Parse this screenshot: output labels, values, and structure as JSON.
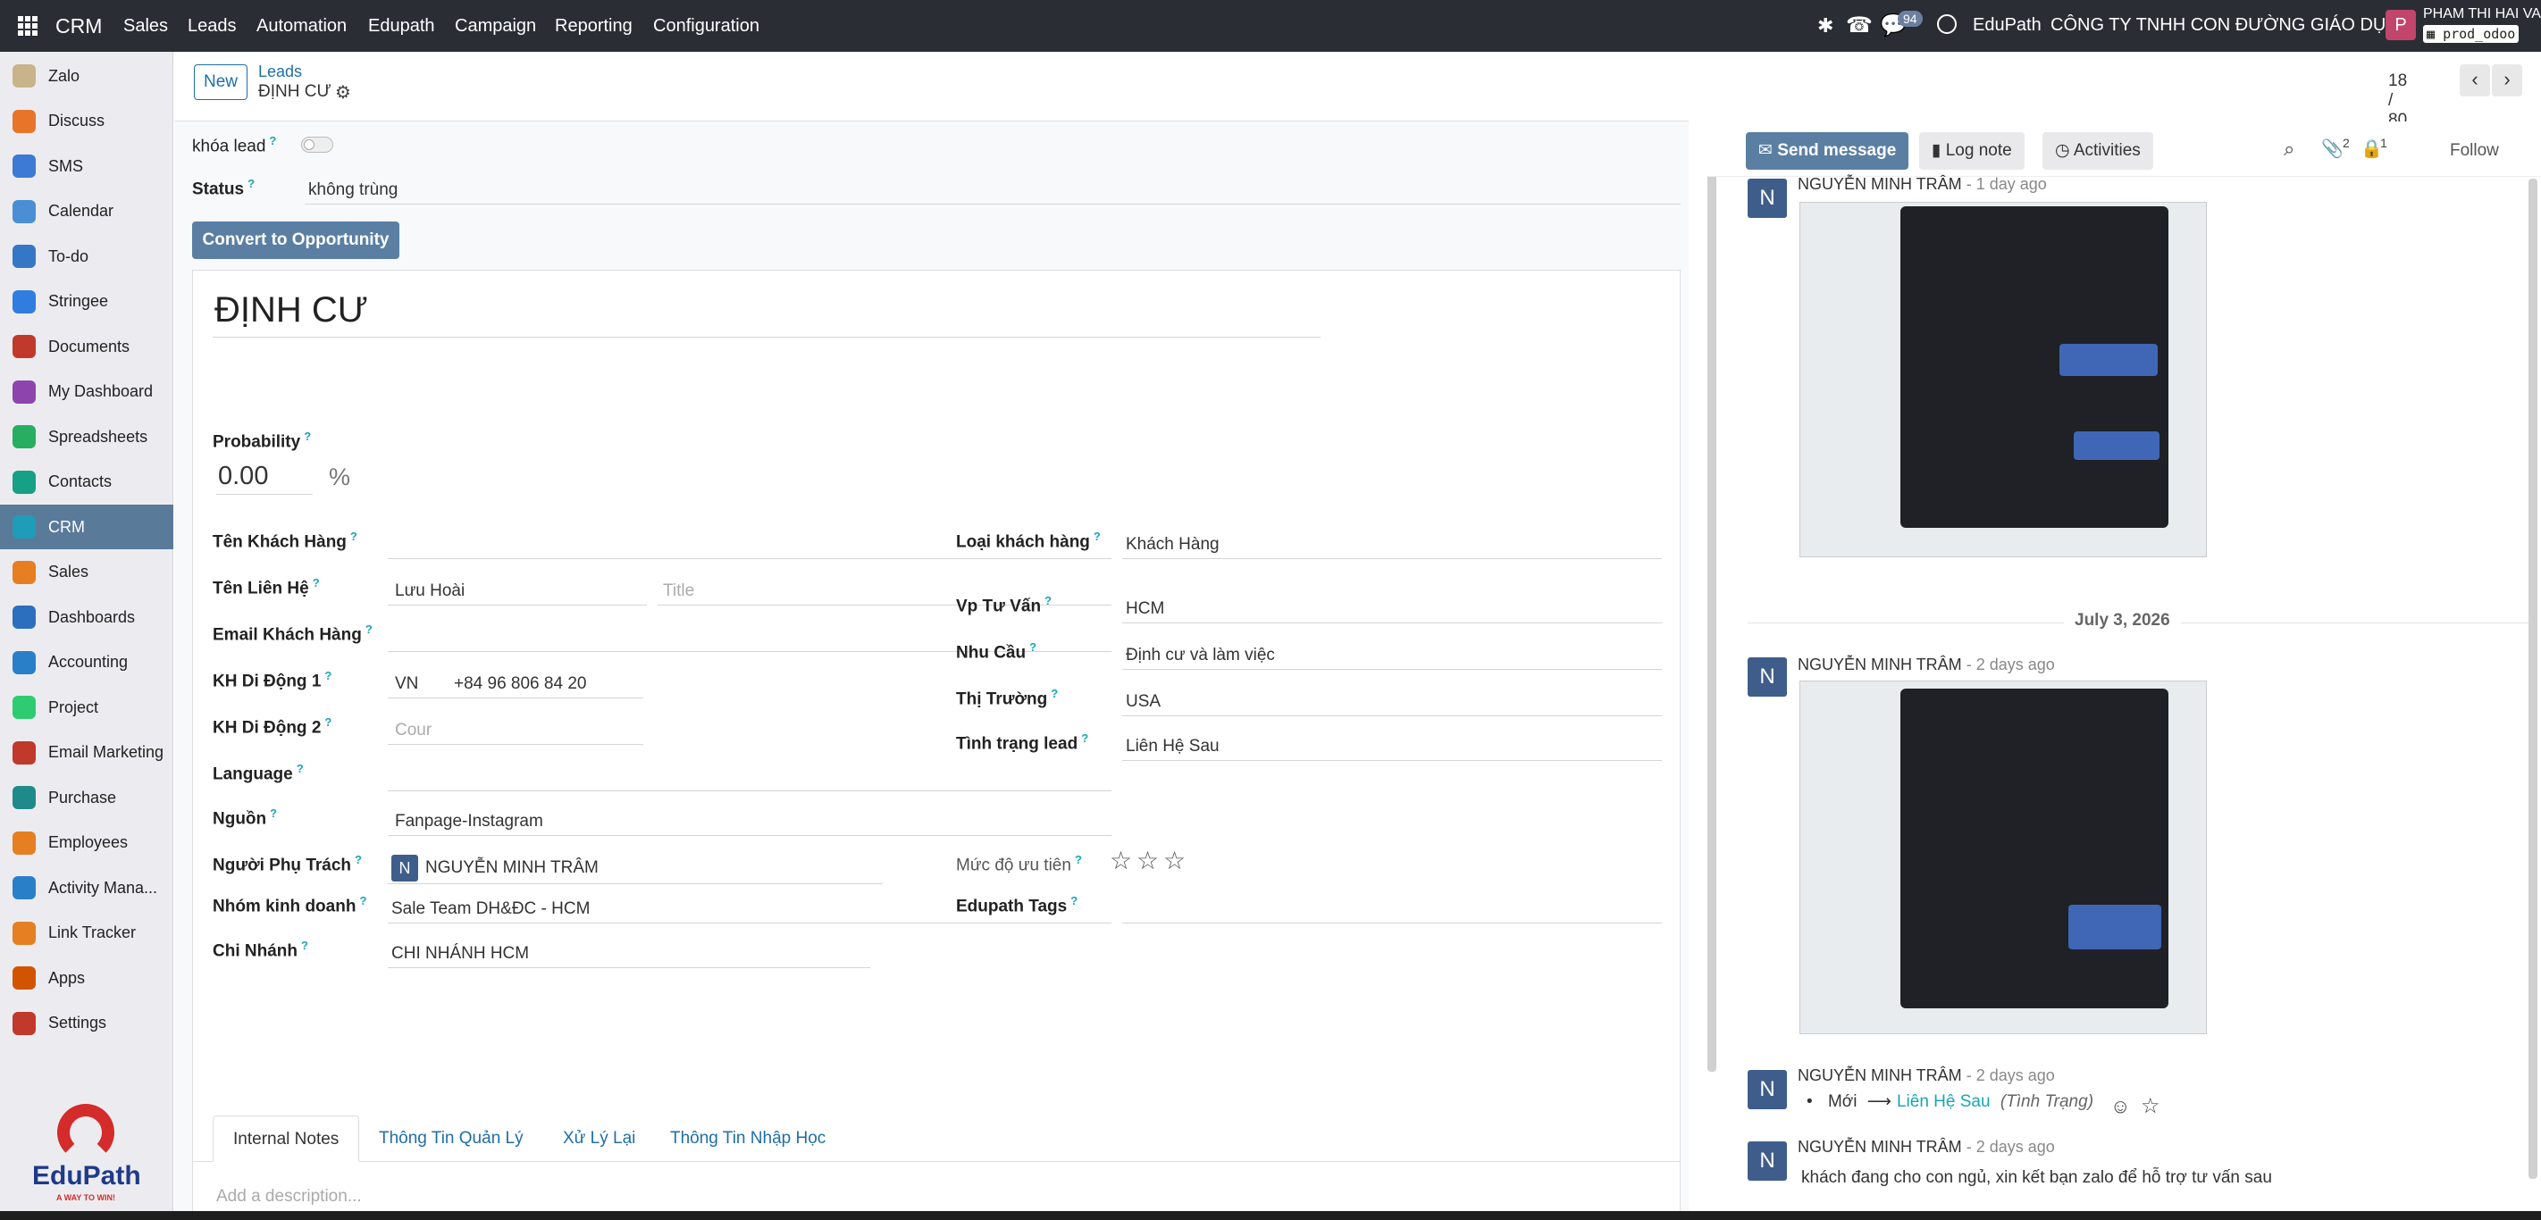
{
  "topbar": {
    "app_name": "CRM",
    "menu": [
      "Sales",
      "Leads",
      "Automation",
      "Edupath",
      "Campaign",
      "Reporting",
      "Configuration"
    ],
    "message_count": "94",
    "company_short": "EduPath",
    "company_full": "CÔNG TY TNHH CON ĐƯỜNG GIÁO DỤC",
    "user_initial": "P",
    "user_name": "PHAM THI HAI VA",
    "db_name": "prod_odoo"
  },
  "sidebar": {
    "items": [
      {
        "label": "Zalo",
        "color": "#c9b38a"
      },
      {
        "label": "Discuss",
        "color": "#e8742a"
      },
      {
        "label": "SMS",
        "color": "#3c7ad6"
      },
      {
        "label": "Calendar",
        "color": "#4a8fd6"
      },
      {
        "label": "To-do",
        "color": "#3577c4"
      },
      {
        "label": "Stringee",
        "color": "#2f7de1"
      },
      {
        "label": "Documents",
        "color": "#c0392b"
      },
      {
        "label": "My Dashboard",
        "color": "#8e44ad"
      },
      {
        "label": "Spreadsheets",
        "color": "#27ae60"
      },
      {
        "label": "Contacts",
        "color": "#16a085"
      },
      {
        "label": "CRM",
        "color": "#1e9cb8"
      },
      {
        "label": "Sales",
        "color": "#e67e22"
      },
      {
        "label": "Dashboards",
        "color": "#2c6fbf"
      },
      {
        "label": "Accounting",
        "color": "#2a7fc9"
      },
      {
        "label": "Project",
        "color": "#2ecc71"
      },
      {
        "label": "Email Marketing",
        "color": "#c0392b"
      },
      {
        "label": "Purchase",
        "color": "#1f8a8a"
      },
      {
        "label": "Employees",
        "color": "#e67e22"
      },
      {
        "label": "Activity Mana...",
        "color": "#2a7fc9"
      },
      {
        "label": "Link Tracker",
        "color": "#e67e22"
      },
      {
        "label": "Apps",
        "color": "#d35400"
      },
      {
        "label": "Settings",
        "color": "#c0392b"
      }
    ],
    "logo_text": "EduPath",
    "logo_tagline": "A WAY TO WIN!"
  },
  "control": {
    "new_label": "New",
    "breadcrumb_parent": "Leads",
    "breadcrumb_current": "ĐỊNH CƯ",
    "pager": "18 / 80"
  },
  "form": {
    "lock_label": "khóa lead",
    "status_label": "Status",
    "status_value": "không trùng",
    "convert_label": "Convert to Opportunity",
    "title": "ĐỊNH CƯ",
    "probability_label": "Probability",
    "probability_value": "0.00",
    "percent": "%",
    "left": {
      "customer_name_label": "Tên Khách Hàng",
      "contact_name_label": "Tên Liên Hệ",
      "contact_name_value": "Lưu Hoài",
      "title_placeholder": "Title",
      "email_label": "Email Khách Hàng",
      "mobile1_label": "KH Di Động 1",
      "mobile1_country": "VN",
      "mobile1_value": "+84 96 806 84 20",
      "mobile2_label": "KH Di Động 2",
      "mobile2_placeholder": "Cour",
      "language_label": "Language",
      "source_label": "Nguồn",
      "source_value": "Fanpage-Instagram",
      "owner_label": "Người Phụ Trách",
      "owner_initial": "N",
      "owner_value": "NGUYỄN MINH TRÂM",
      "team_label": "Nhóm kinh doanh",
      "team_value": "Sale Team DH&ĐC - HCM",
      "branch_label": "Chi Nhánh",
      "branch_value": "CHI NHÁNH HCM"
    },
    "right": {
      "customer_type_label": "Loại khách hàng",
      "customer_type_value": "Khách Hàng",
      "office_label": "Vp Tư Vấn",
      "office_value": "HCM",
      "need_label": "Nhu Cầu",
      "need_value": "Định cư và làm việc",
      "market_label": "Thị Trường",
      "market_value": "USA",
      "lead_state_label": "Tình trạng lead",
      "lead_state_value": "Liên Hệ Sau",
      "priority_label": "Mức độ ưu tiên",
      "stars": 3,
      "tags_label": "Edupath Tags"
    },
    "tabs": [
      "Internal Notes",
      "Thông Tin Quản Lý",
      "Xử Lý Lại",
      "Thông Tin Nhập Học"
    ],
    "description_placeholder": "Add a description..."
  },
  "chatter": {
    "send_message": "Send message",
    "log_note": "Log note",
    "activities": "Activities",
    "attachments_count": "2",
    "followers_count": "1",
    "follow": "Follow",
    "date_separator": "July 3, 2026",
    "messages": [
      {
        "initial": "N",
        "author": "NGUYỄN MINH TRÂM",
        "when": "- 1 day ago"
      },
      {
        "initial": "N",
        "author": "NGUYỄN MINH TRÂM",
        "when": "- 2 days ago"
      },
      {
        "initial": "N",
        "author": "NGUYỄN MINH TRÂM",
        "when": "- 2 days ago",
        "old_value": "Mới",
        "new_value": "Liên Hệ Sau",
        "field": "(Tình Trạng)"
      },
      {
        "initial": "N",
        "author": "NGUYỄN MINH TRÂM",
        "when": "- 2 days ago",
        "body": "khách đang cho con ngủ, xin kết bạn zalo để hỗ trợ tư vấn sau"
      }
    ]
  }
}
